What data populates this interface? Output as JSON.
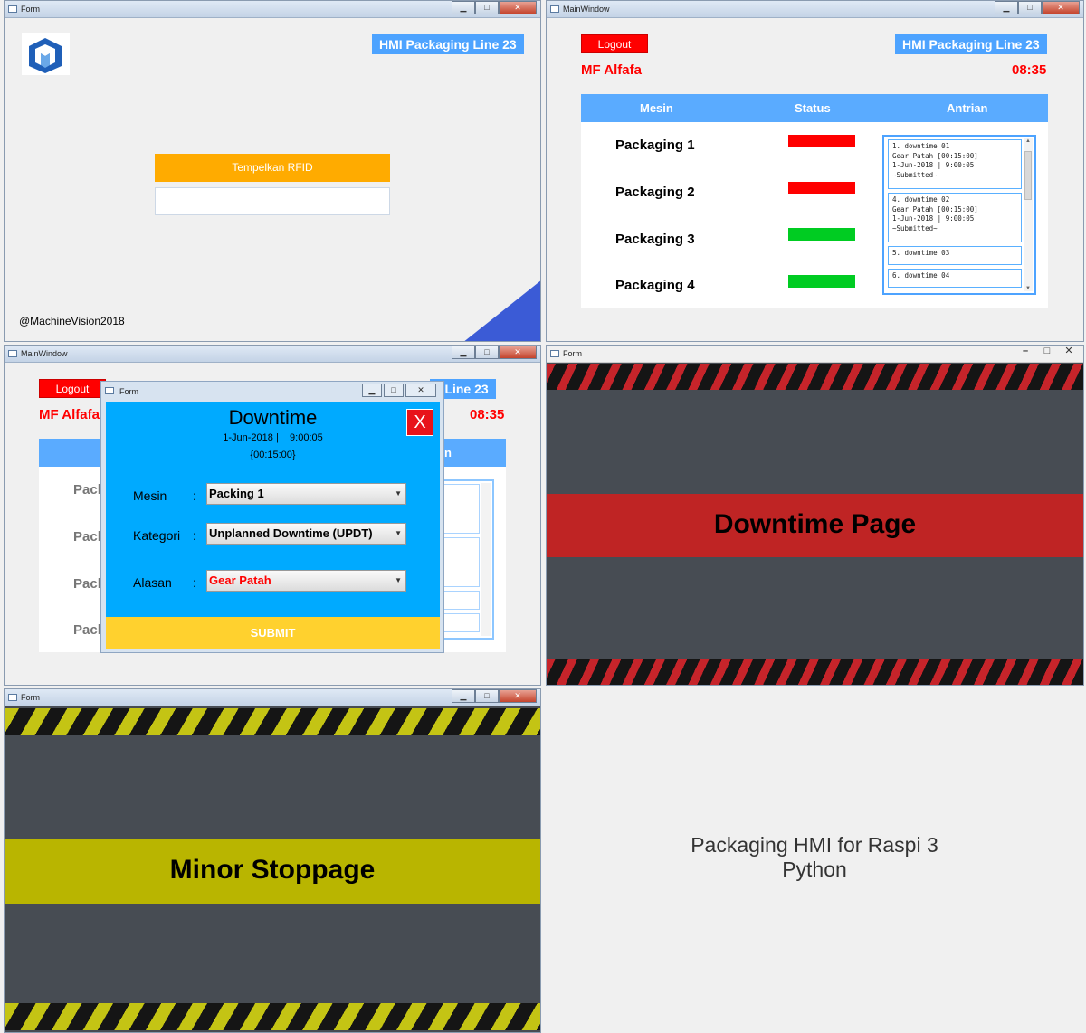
{
  "login_window": {
    "title": "Form",
    "hmi_title": "HMI Packaging Line 23",
    "rfid_label": "Tempelkan RFID",
    "rfid_value": "",
    "footer": "@MachineVision2018"
  },
  "main_window": {
    "title": "MainWindow",
    "logout_label": "Logout",
    "hmi_title": "HMI Packaging Line 23",
    "user": "MF Alfafa",
    "time": "08:35",
    "columns": [
      "Mesin",
      "Status",
      "Antrian"
    ],
    "machines": [
      {
        "name": "Packaging 1",
        "status": "down",
        "color": "#ff0000"
      },
      {
        "name": "Packaging 2",
        "status": "down",
        "color": "#ff0000"
      },
      {
        "name": "Packaging 3",
        "status": "running",
        "color": "#00cc22"
      },
      {
        "name": "Packaging 4",
        "status": "running",
        "color": "#00cc22"
      }
    ],
    "queue": [
      {
        "lines": [
          "1. downtime 01",
          "Gear Patah [00:15:00]",
          "1-Jun-2018 | 9:00:05",
          "~Submitted~"
        ]
      },
      {
        "lines": [
          "4. downtime 02",
          "Gear Patah [00:15:00]",
          "1-Jun-2018 | 9:00:05",
          "~Submitted~"
        ]
      },
      {
        "lines": [
          "5. downtime 03"
        ]
      },
      {
        "lines": [
          "6. downtime 04"
        ]
      }
    ]
  },
  "downtime_dialog_screen": {
    "window_title": "MainWindow",
    "logout_label": "Logout",
    "hmi_title_partial": "g Line 23",
    "user_partial": "MF Alfafa",
    "time": "08:35",
    "column_partial": "n",
    "row_partial": "Pacl",
    "dialog": {
      "title_bar": "Form",
      "heading": "Downtime",
      "date_time": "1-Jun-2018 |    9:00:05",
      "duration": "{00:15:00}",
      "close_label": "X",
      "fields": [
        {
          "label": "Mesin",
          "value": "Packing 1",
          "value_color": "#000000"
        },
        {
          "label": "Kategori",
          "value": "Unplanned Downtime (UPDT)",
          "value_color": "#000000"
        },
        {
          "label": "Alasan",
          "value": "Gear Patah",
          "value_color": "#ff0000"
        }
      ],
      "submit_label": "SUBMIT"
    }
  },
  "downtime_page": {
    "title": "Form",
    "banner": "Downtime Page",
    "banner_color": "#bf2424",
    "stripe_color": "#c6242a"
  },
  "minor_stoppage_page": {
    "title": "Form",
    "banner": "Minor Stoppage",
    "banner_color": "#b9b500",
    "stripe_color": "#c4c414"
  },
  "caption": {
    "line1": "Packaging HMI for Raspi 3",
    "line2": "Python"
  }
}
